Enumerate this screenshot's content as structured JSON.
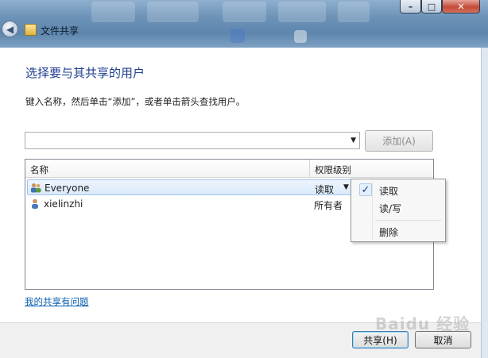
{
  "window": {
    "title": "文件共享",
    "minimize_glyph": "–",
    "maximize_glyph": "□",
    "close_glyph": "✕",
    "back_glyph": "◀"
  },
  "content": {
    "heading": "选择要与其共享的用户",
    "instruction": "键入名称，然后单击“添加”，或者单击箭头查找用户。",
    "name_input": {
      "value": "",
      "dropdown_glyph": "▼"
    },
    "add_button_label": "添加(A)",
    "list": {
      "columns": [
        "名称",
        "权限级别"
      ],
      "rows": [
        {
          "name": "Everyone",
          "permission": "读取",
          "icon": "group-users-icon",
          "dropdown_glyph": "▼"
        },
        {
          "name": "xielinzhi",
          "permission": "所有者",
          "icon": "user-icon"
        }
      ]
    },
    "help_link": "我的共享有问题"
  },
  "permission_menu": {
    "items": [
      {
        "label": "读取",
        "checked": true,
        "check_glyph": "✓"
      },
      {
        "label": "读/写",
        "checked": false
      },
      {
        "label": "删除",
        "checked": false
      }
    ]
  },
  "footer": {
    "share_button_label": "共享(H)",
    "cancel_button_label": "取消"
  },
  "watermark": "Baidu 经验",
  "colors": {
    "heading": "#1f3f8f",
    "link": "#0b5fb0",
    "selection_border": "#9ec4ec",
    "titlebar": "#6d93b8"
  }
}
